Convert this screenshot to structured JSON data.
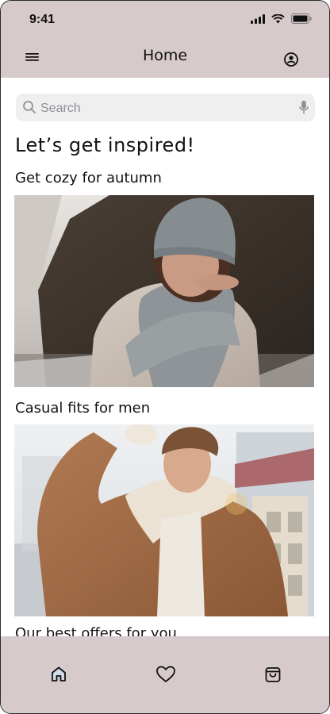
{
  "status_bar": {
    "time": "9:41"
  },
  "app_bar": {
    "title": "Home"
  },
  "search": {
    "placeholder": "Search",
    "value": ""
  },
  "main": {
    "heading": "Let’s get inspired!",
    "sections": [
      {
        "title": "Get cozy for autumn"
      },
      {
        "title": "Casual fits for men"
      },
      {
        "title": "Our best offers for you"
      }
    ]
  },
  "bottom_nav": {
    "items": [
      {
        "icon": "home-icon"
      },
      {
        "icon": "heart-icon"
      },
      {
        "icon": "shopping-bag-icon"
      }
    ]
  },
  "colors": {
    "bar_background": "#d7cacb",
    "search_background": "#efeff0",
    "home_icon_tint": "#cfd8e6"
  }
}
